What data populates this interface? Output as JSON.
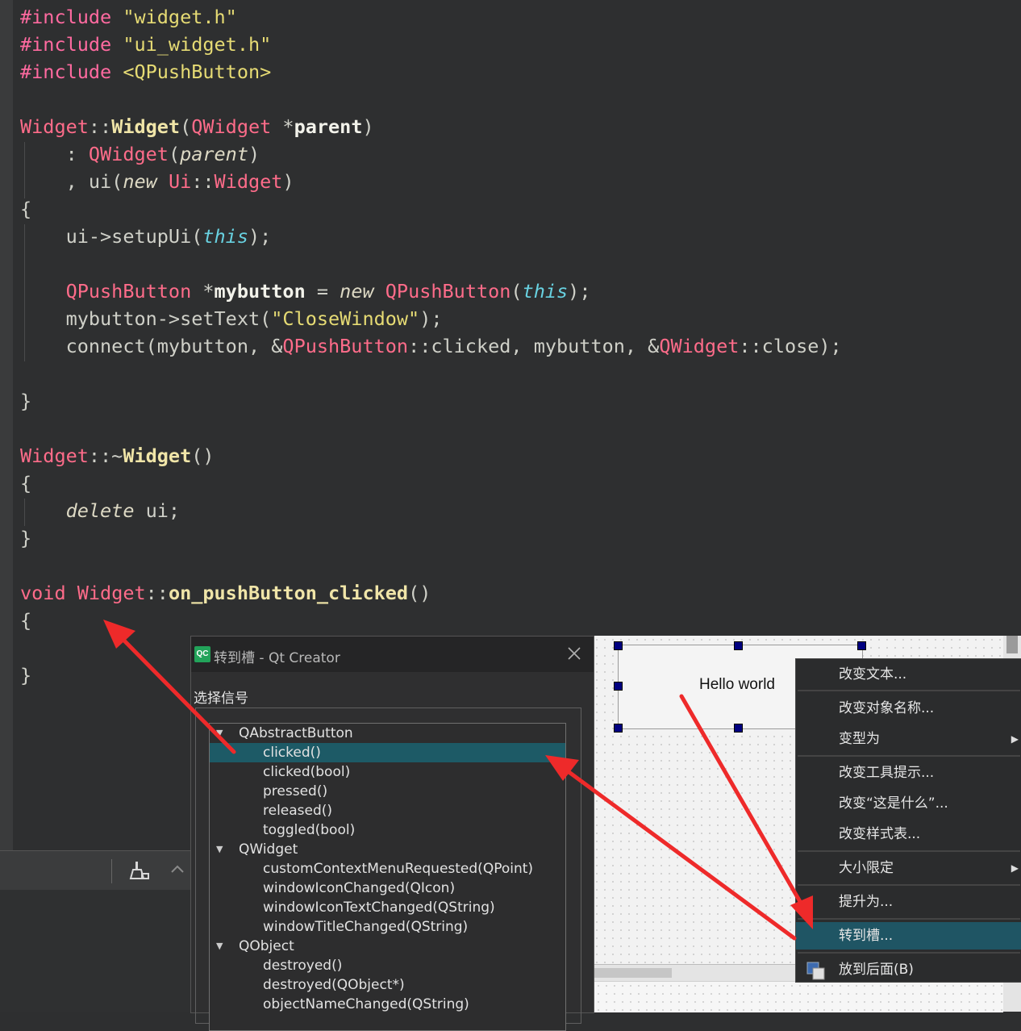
{
  "editor": {
    "lines": [
      [
        {
          "t": "#include ",
          "c": "pre"
        },
        {
          "t": "\"widget.h\"",
          "c": "str"
        }
      ],
      [
        {
          "t": "#include ",
          "c": "pre"
        },
        {
          "t": "\"ui_widget.h\"",
          "c": "str"
        }
      ],
      [
        {
          "t": "#include ",
          "c": "pre"
        },
        {
          "t": "<QPushButton>",
          "c": "ang"
        }
      ],
      [],
      [
        {
          "t": "Widget",
          "c": "cls"
        },
        {
          "t": "::",
          "c": "plain"
        },
        {
          "t": "Widget",
          "c": "fn"
        },
        {
          "t": "(",
          "c": "plain"
        },
        {
          "t": "QWidget",
          "c": "cls"
        },
        {
          "t": " *",
          "c": "plain"
        },
        {
          "t": "parent",
          "c": "bold"
        },
        {
          "t": ")",
          "c": "plain"
        }
      ],
      [
        {
          "t": "    : ",
          "c": "plain"
        },
        {
          "t": "QWidget",
          "c": "cls"
        },
        {
          "t": "(",
          "c": "plain"
        },
        {
          "t": "parent",
          "c": "kw"
        },
        {
          "t": ")",
          "c": "plain"
        }
      ],
      [
        {
          "t": "    , ui(",
          "c": "plain"
        },
        {
          "t": "new",
          "c": "kw"
        },
        {
          "t": " ",
          "c": "plain"
        },
        {
          "t": "Ui",
          "c": "cls"
        },
        {
          "t": "::",
          "c": "plain"
        },
        {
          "t": "Widget",
          "c": "cls"
        },
        {
          "t": ")",
          "c": "plain"
        }
      ],
      [
        {
          "t": "{",
          "c": "plain"
        }
      ],
      [
        {
          "t": "    ui->setupUi(",
          "c": "plain"
        },
        {
          "t": "this",
          "c": "this"
        },
        {
          "t": ");",
          "c": "plain"
        }
      ],
      [],
      [
        {
          "t": "    ",
          "c": "plain"
        },
        {
          "t": "QPushButton",
          "c": "cls"
        },
        {
          "t": " *",
          "c": "plain"
        },
        {
          "t": "mybutton",
          "c": "bold"
        },
        {
          "t": " = ",
          "c": "plain"
        },
        {
          "t": "new",
          "c": "kw"
        },
        {
          "t": " ",
          "c": "plain"
        },
        {
          "t": "QPushButton",
          "c": "cls"
        },
        {
          "t": "(",
          "c": "plain"
        },
        {
          "t": "this",
          "c": "this"
        },
        {
          "t": ");",
          "c": "plain"
        }
      ],
      [
        {
          "t": "    mybutton->setText(",
          "c": "plain"
        },
        {
          "t": "\"CloseWindow\"",
          "c": "str"
        },
        {
          "t": ");",
          "c": "plain"
        }
      ],
      [
        {
          "t": "    connect(mybutton, &",
          "c": "plain"
        },
        {
          "t": "QPushButton",
          "c": "cls"
        },
        {
          "t": "::clicked, mybutton, &",
          "c": "plain"
        },
        {
          "t": "QWidget",
          "c": "cls"
        },
        {
          "t": "::close);",
          "c": "plain"
        }
      ],
      [],
      [
        {
          "t": "}",
          "c": "plain"
        }
      ],
      [],
      [
        {
          "t": "Widget",
          "c": "cls"
        },
        {
          "t": "::~",
          "c": "plain"
        },
        {
          "t": "Widget",
          "c": "fn"
        },
        {
          "t": "()",
          "c": "plain"
        }
      ],
      [
        {
          "t": "{",
          "c": "plain"
        }
      ],
      [
        {
          "t": "    ",
          "c": "plain"
        },
        {
          "t": "delete",
          "c": "kw"
        },
        {
          "t": " ui;",
          "c": "plain"
        }
      ],
      [
        {
          "t": "}",
          "c": "plain"
        }
      ],
      [],
      [
        {
          "t": "void",
          "c": "kw2"
        },
        {
          "t": " ",
          "c": "plain"
        },
        {
          "t": "Widget",
          "c": "cls"
        },
        {
          "t": "::",
          "c": "plain"
        },
        {
          "t": "on_pushButton_clicked",
          "c": "fn"
        },
        {
          "t": "()",
          "c": "plain"
        }
      ],
      [
        {
          "t": "{",
          "c": "plain"
        }
      ],
      [],
      [
        {
          "t": "}",
          "c": "plain"
        }
      ]
    ]
  },
  "designer": {
    "button_text": "Hello world"
  },
  "context_menu": {
    "items": [
      {
        "label": "改变文本...",
        "submenu": false,
        "active": false
      },
      {
        "label": "改变对象名称...",
        "submenu": false,
        "active": false
      },
      {
        "label": "变型为",
        "submenu": true,
        "active": false
      },
      {
        "label": "改变工具提示...",
        "submenu": false,
        "active": false
      },
      {
        "label": "改变“这是什么”...",
        "submenu": false,
        "active": false
      },
      {
        "label": "改变样式表...",
        "submenu": false,
        "active": false
      },
      {
        "label": "大小限定",
        "submenu": true,
        "active": false
      },
      {
        "label": "提升为...",
        "submenu": false,
        "active": false
      },
      {
        "label": "转到槽...",
        "submenu": false,
        "active": true
      },
      {
        "label": "放到后面(B)",
        "submenu": false,
        "active": false
      }
    ]
  },
  "dialog": {
    "logo": "QC",
    "title": "转到槽 - Qt Creator",
    "select_label": "选择信号",
    "tree": [
      {
        "label": "QAbstractButton",
        "level": 0,
        "selected": false
      },
      {
        "label": "clicked()",
        "level": 1,
        "selected": true
      },
      {
        "label": "clicked(bool)",
        "level": 1,
        "selected": false
      },
      {
        "label": "pressed()",
        "level": 1,
        "selected": false
      },
      {
        "label": "released()",
        "level": 1,
        "selected": false
      },
      {
        "label": "toggled(bool)",
        "level": 1,
        "selected": false
      },
      {
        "label": "QWidget",
        "level": 0,
        "selected": false
      },
      {
        "label": "customContextMenuRequested(QPoint)",
        "level": 1,
        "selected": false
      },
      {
        "label": "windowIconChanged(QIcon)",
        "level": 1,
        "selected": false
      },
      {
        "label": "windowIconTextChanged(QString)",
        "level": 1,
        "selected": false
      },
      {
        "label": "windowTitleChanged(QString)",
        "level": 1,
        "selected": false
      },
      {
        "label": "QObject",
        "level": 0,
        "selected": false
      },
      {
        "label": "destroyed()",
        "level": 1,
        "selected": false
      },
      {
        "label": "destroyed(QObject*)",
        "level": 1,
        "selected": false
      },
      {
        "label": "objectNameChanged(QString)",
        "level": 1,
        "selected": false
      }
    ]
  },
  "colors": {
    "arrow": "#ee2a2a",
    "selection": "#1d5a66",
    "editor_bg": "#2e2f30"
  }
}
